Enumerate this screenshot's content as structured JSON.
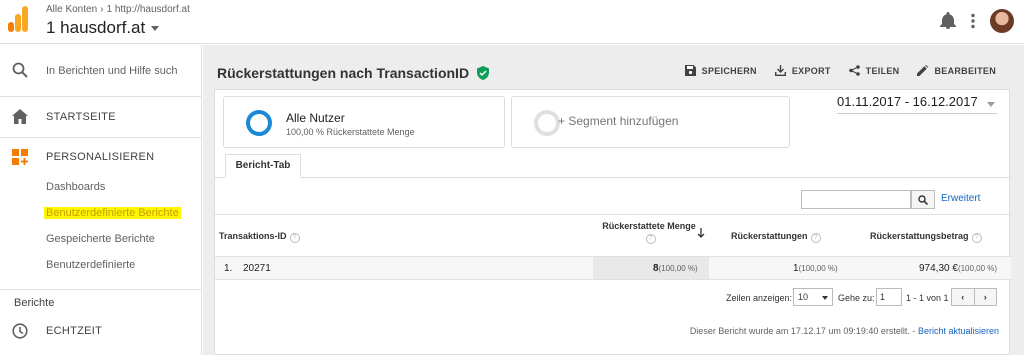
{
  "header": {
    "breadcrumb": [
      "Alle Konten",
      "1 http://hausdorf.at"
    ],
    "property": "1 hausdorf.at"
  },
  "sidebar": {
    "search_placeholder": "In Berichten und Hilfe such",
    "home_label": "STARTSEITE",
    "customize_label": "PERSONALISIEREN",
    "sub_items": [
      "Dashboards",
      "Benutzerdefinierte Berichte",
      "Gespeicherte Berichte",
      "Benutzerdefinierte"
    ],
    "section_label": "Berichte",
    "realtime_label": "ECHTZEIT"
  },
  "report": {
    "title": "Rückerstattungen nach TransactionID",
    "actions": [
      "SPEICHERN",
      "EXPORT",
      "TEILEN",
      "BEARBEITEN"
    ],
    "segment1_title": "Alle Nutzer",
    "segment1_sub": "100,00 % Rückerstattete Menge",
    "segment2_title": "+ Segment hinzufügen",
    "date_range": "01.11.2017 - 16.12.2017",
    "tab_label": "Bericht-Tab",
    "advanced_link": "Erweitert",
    "columns": [
      "Transaktions-ID",
      "Rückerstattete Menge",
      "Rückerstattungen",
      "Rückerstattungsbetrag"
    ],
    "row": {
      "index": "1.",
      "id": "20271",
      "qty": "8",
      "qty_pct": "(100,00 %)",
      "refunds": "1",
      "refunds_pct": "(100,00 %)",
      "amount": "974,30 €",
      "amount_pct": "(100,00 %)"
    },
    "pager": {
      "rows_label": "Zeilen anzeigen:",
      "rows_value": "10",
      "goto_label": "Gehe zu:",
      "goto_value": "1",
      "range": "1 - 1 von 1"
    },
    "footnote": "Dieser Bericht wurde am 17.12.17 um 09:19:40 erstellt. -",
    "refresh_link": "Bericht aktualisieren"
  }
}
